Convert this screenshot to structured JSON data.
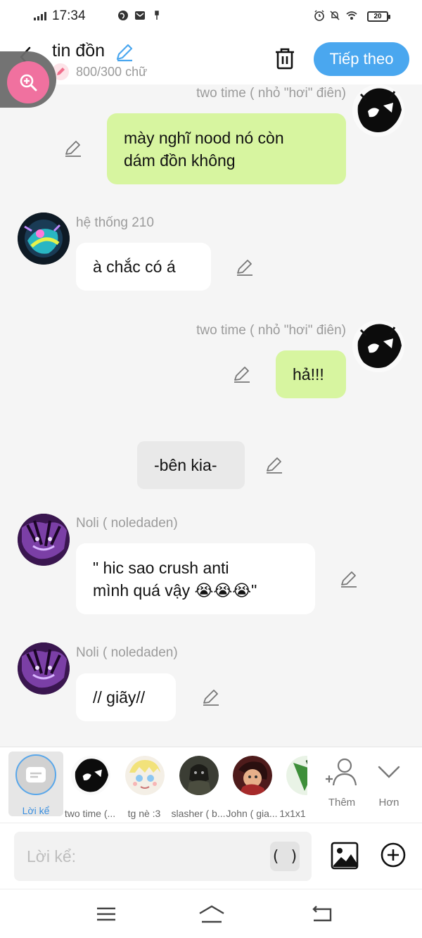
{
  "status_bar": {
    "time": "17:34",
    "battery": "20"
  },
  "header": {
    "title": "tin đồn",
    "counter": "800/300 chữ",
    "next_label": "Tiếp theo"
  },
  "messages": [
    {
      "side": "right",
      "name": "two time ( nhỏ \"hơi\" điên)",
      "lines": [
        "mày nghĩ nood nó còn",
        "dám đồn không"
      ]
    },
    {
      "side": "left",
      "name": "hệ thống 210",
      "lines": [
        "à chắc có  á"
      ]
    },
    {
      "side": "right",
      "name": "two time ( nhỏ \"hơi\" điên)",
      "lines": [
        "hả!!!"
      ]
    },
    {
      "side": "center",
      "lines": [
        "-bên kia-"
      ]
    },
    {
      "side": "left",
      "name": "Noli ( noledaden)",
      "lines": [
        "\" hic sao crush anti",
        "mình quá vậy 😭😭😭\""
      ]
    },
    {
      "side": "left",
      "name": "Noli ( noledaden)",
      "lines": [
        "// giãy//"
      ]
    }
  ],
  "characters": {
    "items": [
      {
        "label": "Lời kể",
        "selected": true
      },
      {
        "label": "two time (..."
      },
      {
        "label": "tg nè :3"
      },
      {
        "label": "slasher ( b..."
      },
      {
        "label": "John ( gia..."
      },
      {
        "label": "1x1x1"
      }
    ],
    "add_label": "Thêm",
    "more_label": "Hơn"
  },
  "composer": {
    "placeholder": "Lời kể:",
    "paren_label": "( )"
  },
  "colors": {
    "accent": "#4aa7ef",
    "bubble_green": "#d7f5a0",
    "zoom_pink": "#f0719f"
  },
  "icons": [
    "back-arrow-icon",
    "pencil-icon",
    "trash-icon",
    "zoom-in-icon",
    "add-person-icon",
    "chevron-down-icon",
    "image-icon",
    "plus-circle-icon",
    "menu-icon",
    "home-icon",
    "back-icon"
  ]
}
